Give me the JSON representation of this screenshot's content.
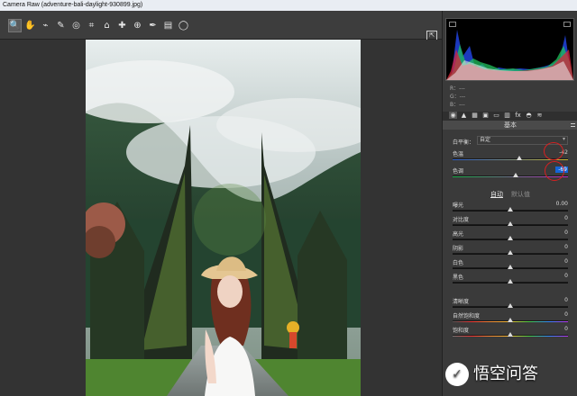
{
  "window": {
    "title": "Camera Raw (adventure-bali-daylight-930899.jpg)"
  },
  "toolbar": {
    "tools": [
      {
        "name": "zoom-tool-icon",
        "glyph": "🔍"
      },
      {
        "name": "hand-tool-icon",
        "glyph": "✋"
      },
      {
        "name": "white-balance-tool-icon",
        "glyph": "⌁"
      },
      {
        "name": "color-sampler-tool-icon",
        "glyph": "✎"
      },
      {
        "name": "targeted-adjustment-icon",
        "glyph": "◎"
      },
      {
        "name": "crop-tool-icon",
        "glyph": "⌗"
      },
      {
        "name": "straighten-tool-icon",
        "glyph": "⌂"
      },
      {
        "name": "spot-removal-tool-icon",
        "glyph": "✚"
      },
      {
        "name": "redeye-tool-icon",
        "glyph": "⊕"
      },
      {
        "name": "adjustment-brush-icon",
        "glyph": "✒"
      },
      {
        "name": "graduated-filter-icon",
        "glyph": "▤"
      },
      {
        "name": "radial-filter-icon",
        "glyph": "◯"
      }
    ],
    "open_preferences_icon": "⇱"
  },
  "histogram": {
    "rgb_labels": [
      "R：---",
      "G：---",
      "B：---"
    ]
  },
  "panel_tabs": [
    "◉",
    "▲",
    "▦",
    "▣",
    "▭",
    "▥",
    "fx",
    "◓",
    "≋"
  ],
  "basic": {
    "title": "基本",
    "white_balance_label": "白平衡：",
    "white_balance_value": "自定",
    "temperature": {
      "label": "色温",
      "value": "-42",
      "thumb_pct": 0.58
    },
    "tint": {
      "label": "色调",
      "value": "-69",
      "thumb_pct": 0.55
    },
    "auto": "自动",
    "default": "默认值",
    "sliders": [
      {
        "name": "exposure",
        "label": "曝光",
        "value": "0.00",
        "thumb_pct": 0.5
      },
      {
        "name": "contrast",
        "label": "对比度",
        "value": "0",
        "thumb_pct": 0.5
      },
      {
        "name": "highlights",
        "label": "高光",
        "value": "0",
        "thumb_pct": 0.5
      },
      {
        "name": "shadows",
        "label": "阴影",
        "value": "0",
        "thumb_pct": 0.5
      },
      {
        "name": "whites",
        "label": "白色",
        "value": "0",
        "thumb_pct": 0.5
      },
      {
        "name": "blacks",
        "label": "黑色",
        "value": "0",
        "thumb_pct": 0.5
      },
      {
        "name": "clarity",
        "label": "清晰度",
        "value": "0",
        "thumb_pct": 0.5
      },
      {
        "name": "vibrance",
        "label": "自然饱和度",
        "value": "0",
        "thumb_pct": 0.5
      },
      {
        "name": "saturation",
        "label": "饱和度",
        "value": "0",
        "thumb_pct": 0.5
      }
    ]
  },
  "watermark": {
    "text": "悟空问答",
    "icon": "✓"
  },
  "colors": {
    "accent": "#1565d8",
    "annotation": "#d82020"
  }
}
